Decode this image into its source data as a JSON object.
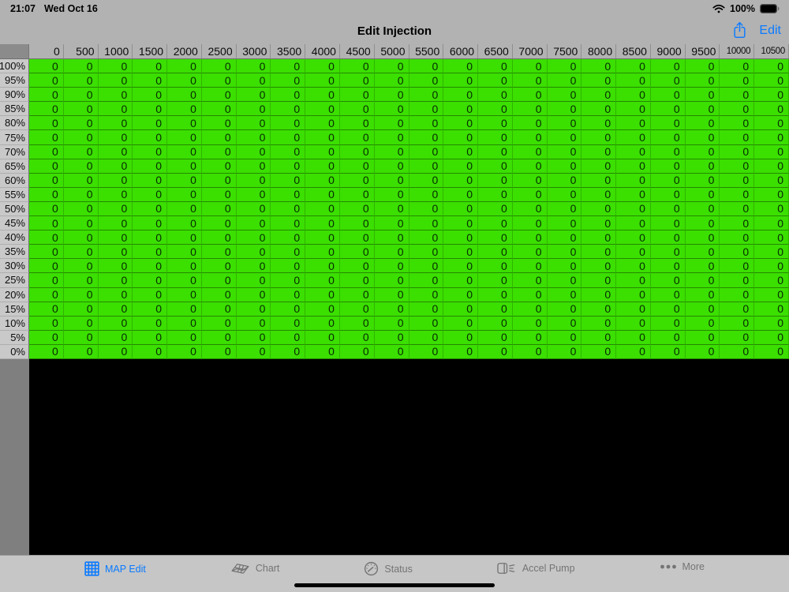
{
  "status_bar": {
    "time": "21:07",
    "date": "Wed Oct 16",
    "battery_percent": "100%",
    "icons": [
      "wifi-icon",
      "battery-icon"
    ]
  },
  "nav_bar": {
    "title": "Edit Injection",
    "share_icon": "share-icon",
    "edit_label": "Edit"
  },
  "table": {
    "col_headers": [
      "0",
      "500",
      "1000",
      "1500",
      "2000",
      "2500",
      "3000",
      "3500",
      "4000",
      "4500",
      "5000",
      "5500",
      "6000",
      "6500",
      "7000",
      "7500",
      "8000",
      "8500",
      "9000",
      "9500",
      "10000",
      "10500"
    ],
    "row_headers": [
      "100%",
      "95%",
      "90%",
      "85%",
      "80%",
      "75%",
      "70%",
      "65%",
      "60%",
      "55%",
      "50%",
      "45%",
      "40%",
      "35%",
      "30%",
      "25%",
      "20%",
      "15%",
      "10%",
      "5%",
      "0%"
    ],
    "rows": [
      [
        0,
        0,
        0,
        0,
        0,
        0,
        0,
        0,
        0,
        0,
        0,
        0,
        0,
        0,
        0,
        0,
        0,
        0,
        0,
        0,
        0,
        0
      ],
      [
        0,
        0,
        0,
        0,
        0,
        0,
        0,
        0,
        0,
        0,
        0,
        0,
        0,
        0,
        0,
        0,
        0,
        0,
        0,
        0,
        0,
        0
      ],
      [
        0,
        0,
        0,
        0,
        0,
        0,
        0,
        0,
        0,
        0,
        0,
        0,
        0,
        0,
        0,
        0,
        0,
        0,
        0,
        0,
        0,
        0
      ],
      [
        0,
        0,
        0,
        0,
        0,
        0,
        0,
        0,
        0,
        0,
        0,
        0,
        0,
        0,
        0,
        0,
        0,
        0,
        0,
        0,
        0,
        0
      ],
      [
        0,
        0,
        0,
        0,
        0,
        0,
        0,
        0,
        0,
        0,
        0,
        0,
        0,
        0,
        0,
        0,
        0,
        0,
        0,
        0,
        0,
        0
      ],
      [
        0,
        0,
        0,
        0,
        0,
        0,
        0,
        0,
        0,
        0,
        0,
        0,
        0,
        0,
        0,
        0,
        0,
        0,
        0,
        0,
        0,
        0
      ],
      [
        0,
        0,
        0,
        0,
        0,
        0,
        0,
        0,
        0,
        0,
        0,
        0,
        0,
        0,
        0,
        0,
        0,
        0,
        0,
        0,
        0,
        0
      ],
      [
        0,
        0,
        0,
        0,
        0,
        0,
        0,
        0,
        0,
        0,
        0,
        0,
        0,
        0,
        0,
        0,
        0,
        0,
        0,
        0,
        0,
        0
      ],
      [
        0,
        0,
        0,
        0,
        0,
        0,
        0,
        0,
        0,
        0,
        0,
        0,
        0,
        0,
        0,
        0,
        0,
        0,
        0,
        0,
        0,
        0
      ],
      [
        0,
        0,
        0,
        0,
        0,
        0,
        0,
        0,
        0,
        0,
        0,
        0,
        0,
        0,
        0,
        0,
        0,
        0,
        0,
        0,
        0,
        0
      ],
      [
        0,
        0,
        0,
        0,
        0,
        0,
        0,
        0,
        0,
        0,
        0,
        0,
        0,
        0,
        0,
        0,
        0,
        0,
        0,
        0,
        0,
        0
      ],
      [
        0,
        0,
        0,
        0,
        0,
        0,
        0,
        0,
        0,
        0,
        0,
        0,
        0,
        0,
        0,
        0,
        0,
        0,
        0,
        0,
        0,
        0
      ],
      [
        0,
        0,
        0,
        0,
        0,
        0,
        0,
        0,
        0,
        0,
        0,
        0,
        0,
        0,
        0,
        0,
        0,
        0,
        0,
        0,
        0,
        0
      ],
      [
        0,
        0,
        0,
        0,
        0,
        0,
        0,
        0,
        0,
        0,
        0,
        0,
        0,
        0,
        0,
        0,
        0,
        0,
        0,
        0,
        0,
        0
      ],
      [
        0,
        0,
        0,
        0,
        0,
        0,
        0,
        0,
        0,
        0,
        0,
        0,
        0,
        0,
        0,
        0,
        0,
        0,
        0,
        0,
        0,
        0
      ],
      [
        0,
        0,
        0,
        0,
        0,
        0,
        0,
        0,
        0,
        0,
        0,
        0,
        0,
        0,
        0,
        0,
        0,
        0,
        0,
        0,
        0,
        0
      ],
      [
        0,
        0,
        0,
        0,
        0,
        0,
        0,
        0,
        0,
        0,
        0,
        0,
        0,
        0,
        0,
        0,
        0,
        0,
        0,
        0,
        0,
        0
      ],
      [
        0,
        0,
        0,
        0,
        0,
        0,
        0,
        0,
        0,
        0,
        0,
        0,
        0,
        0,
        0,
        0,
        0,
        0,
        0,
        0,
        0,
        0
      ],
      [
        0,
        0,
        0,
        0,
        0,
        0,
        0,
        0,
        0,
        0,
        0,
        0,
        0,
        0,
        0,
        0,
        0,
        0,
        0,
        0,
        0,
        0
      ],
      [
        0,
        0,
        0,
        0,
        0,
        0,
        0,
        0,
        0,
        0,
        0,
        0,
        0,
        0,
        0,
        0,
        0,
        0,
        0,
        0,
        0,
        0
      ],
      [
        0,
        0,
        0,
        0,
        0,
        0,
        0,
        0,
        0,
        0,
        0,
        0,
        0,
        0,
        0,
        0,
        0,
        0,
        0,
        0,
        0,
        0
      ]
    ],
    "cell_color": "#3bdf00"
  },
  "tab_bar": {
    "items": [
      {
        "label": "MAP Edit",
        "icon": "grid-icon",
        "selected": true
      },
      {
        "label": "Chart",
        "icon": "mesh-chart-icon",
        "selected": false
      },
      {
        "label": "Status",
        "icon": "gauge-icon",
        "selected": false
      },
      {
        "label": "Accel Pump",
        "icon": "pump-icon",
        "selected": false
      },
      {
        "label": "More",
        "icon": "ellipsis-icon",
        "selected": false
      }
    ]
  },
  "colors": {
    "accent_blue": "#0a7aff",
    "cell_green": "#3bdf00",
    "bar_gray": "#b2b2b2",
    "tab_bar_gray": "#c6c6c6",
    "row_header_gray": "#c9c9c9",
    "corner_gray": "#8b8b8b"
  }
}
